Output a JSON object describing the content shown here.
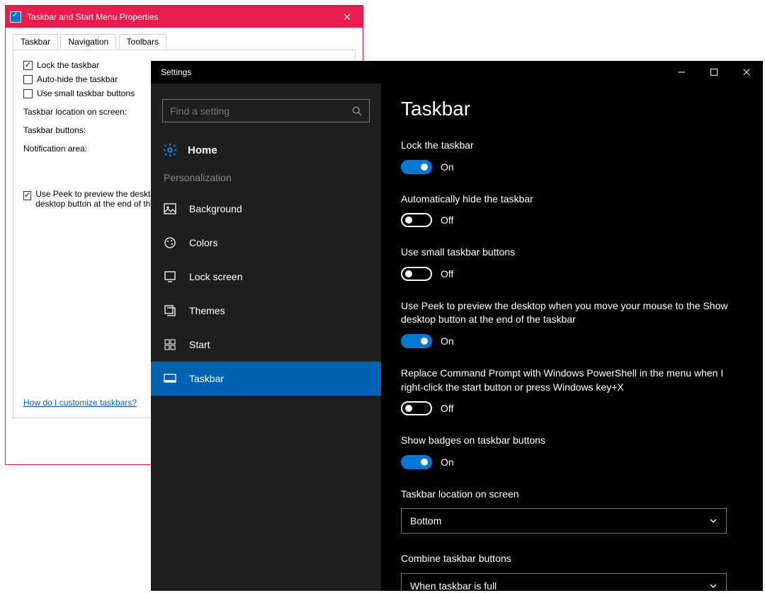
{
  "classic": {
    "title": "Taskbar and Start Menu Properties",
    "tabs": [
      "Taskbar",
      "Navigation",
      "Toolbars"
    ],
    "active_tab": 0,
    "options": {
      "lock": {
        "label": "Lock the taskbar",
        "checked": true
      },
      "autohide": {
        "label": "Auto-hide the taskbar",
        "checked": false
      },
      "small": {
        "label": "Use small taskbar buttons",
        "checked": false
      }
    },
    "location_label": "Taskbar location on screen:",
    "buttons_label": "Taskbar buttons:",
    "notification_label": "Notification area:",
    "peek": {
      "label": "Use Peek to preview the desktop when you move your mouse to the Show desktop button at the end of the taskbar",
      "checked": true
    },
    "help_link": "How do I customize taskbars?"
  },
  "settings": {
    "app_title": "Settings",
    "search_placeholder": "Find a setting",
    "home_label": "Home",
    "section_title": "Personalization",
    "nav_items": [
      {
        "label": "Background",
        "selected": false
      },
      {
        "label": "Colors",
        "selected": false
      },
      {
        "label": "Lock screen",
        "selected": false
      },
      {
        "label": "Themes",
        "selected": false
      },
      {
        "label": "Start",
        "selected": false
      },
      {
        "label": "Taskbar",
        "selected": true
      }
    ],
    "page_title": "Taskbar",
    "toggles": {
      "lock": {
        "label": "Lock the taskbar",
        "on": true
      },
      "autohide": {
        "label": "Automatically hide the taskbar",
        "on": false
      },
      "small": {
        "label": "Use small taskbar buttons",
        "on": false
      },
      "peek": {
        "label": "Use Peek to preview the desktop when you move your mouse to the Show desktop button at the end of the taskbar",
        "on": true
      },
      "powershell": {
        "label": "Replace Command Prompt with Windows PowerShell in the menu when I right-click the start button or press Windows key+X",
        "on": false
      },
      "badges": {
        "label": "Show badges on taskbar buttons",
        "on": true
      }
    },
    "state_on": "On",
    "state_off": "Off",
    "location": {
      "label": "Taskbar location on screen",
      "value": "Bottom"
    },
    "combine": {
      "label": "Combine taskbar buttons",
      "value": "When taskbar is full"
    }
  }
}
